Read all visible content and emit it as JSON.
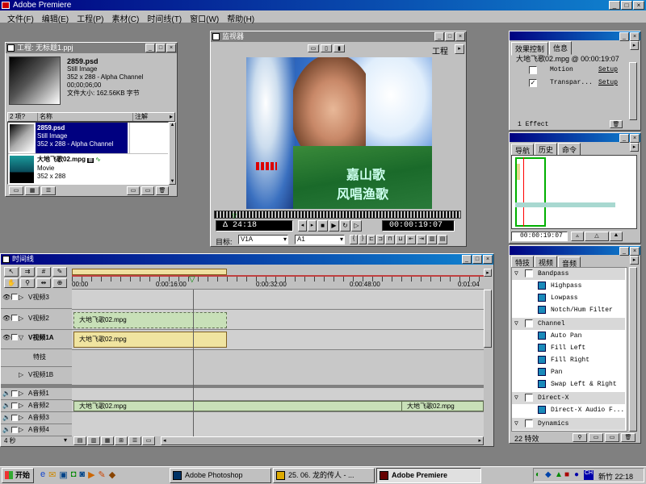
{
  "app": {
    "title": "Adobe Premiere"
  },
  "menu": [
    "文件(F)",
    "编辑(E)",
    "工程(P)",
    "素材(C)",
    "时间线(T)",
    "窗口(W)",
    "帮助(H)"
  ],
  "project": {
    "title": "工程: 无标题1.ppj",
    "thumb_name": "2859.psd",
    "thumb_type": "Still Image",
    "thumb_dims": "352 x 288 - Alpha Channel",
    "thumb_duration": "00;00;06;00",
    "thumb_size": "文件大小: 162.56KB 字节",
    "count_label": "2 项?",
    "col_name": "名称",
    "col_notes": "注解",
    "items": [
      {
        "name": "2859.psd",
        "type": "Still Image",
        "dims": "352 x 288 - Alpha Channel"
      },
      {
        "name": "大地飞歌02.mpg",
        "type": "Movie",
        "dims": "352 x 288"
      }
    ]
  },
  "monitor": {
    "title": "监视器",
    "workspace": "工程",
    "timecode_left": "Δ 24:18",
    "timecode_right": "00:00:19:07",
    "target_label": "目标:",
    "video_target": "V1A",
    "audio_target": "A1",
    "overlay_text1": "嘉山歌",
    "overlay_text2": "风唱渔歌"
  },
  "effects": {
    "tab1": "效果控制",
    "tab2": "信息",
    "clip_label": "大地飞歌02.mpg @ 00:00:19:07",
    "rows": [
      {
        "name": "Motion",
        "link": "Setup"
      },
      {
        "name": "Transpar...",
        "link": "Setup"
      }
    ],
    "count": "1 Effect"
  },
  "nav": {
    "tabs": [
      "导航",
      "历史",
      "命令"
    ],
    "timecode": "00:00:19:07"
  },
  "fxlist": {
    "tabs": [
      "特技",
      "视频",
      "音频"
    ],
    "count": "22 特效",
    "items": [
      {
        "name": "Bandpass",
        "folder": true
      },
      {
        "name": "Highpass",
        "folder": false
      },
      {
        "name": "Lowpass",
        "folder": false
      },
      {
        "name": "Notch/Hum Filter",
        "folder": false
      },
      {
        "name": "Channel",
        "folder": true
      },
      {
        "name": "Auto Pan",
        "folder": false
      },
      {
        "name": "Fill Left",
        "folder": false
      },
      {
        "name": "Fill Right",
        "folder": false
      },
      {
        "name": "Pan",
        "folder": false
      },
      {
        "name": "Swap Left & Right",
        "folder": false
      },
      {
        "name": "Direct-X",
        "folder": true
      },
      {
        "name": "Direct-X Audio F...",
        "folder": false
      },
      {
        "name": "Dynamics",
        "folder": true
      }
    ]
  },
  "timeline": {
    "title": "时间线",
    "ruler": [
      "00:00",
      "0:00:16:00",
      "0:00:32:00",
      "0:00:48:00",
      "0:01:04"
    ],
    "tracks": {
      "v3": "V视频3",
      "v2": "V视频2",
      "v1a": "V视频1A",
      "trans": "特技",
      "v1b": "V视频1B",
      "a1": "A音频1",
      "a2": "A音频2",
      "a3": "A音频3",
      "a4": "A音频4"
    },
    "clip_v2": "大地飞歌02.mpg",
    "clip_v1a": "大地飞歌02.mpg",
    "clip_a2a": "大地飞歌02.mpg",
    "clip_a2b": "大地飞歌02.mpg",
    "zoom": "4 秒"
  },
  "taskbar": {
    "start": "开始",
    "tasks": [
      "Adobe Photoshop",
      "25. 06. 龙的传人 - ...",
      "Adobe Premiere"
    ],
    "clock": "新竹 22:18"
  }
}
